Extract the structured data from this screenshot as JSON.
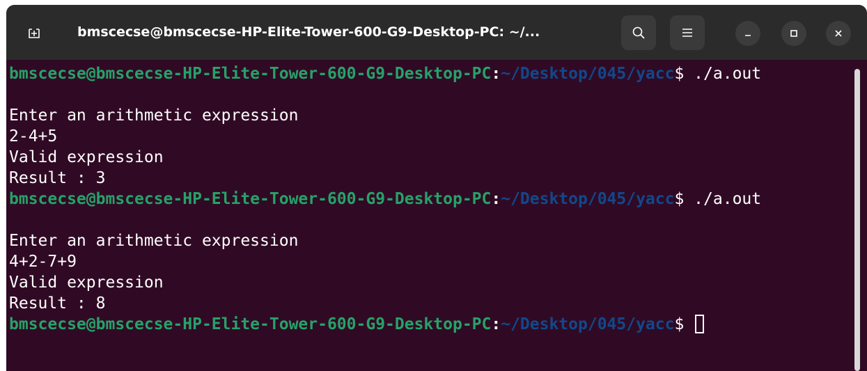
{
  "window": {
    "title": "bmscecse@bmscecse-HP-Elite-Tower-600-G9-Desktop-PC: ~/..."
  },
  "header_buttons": {
    "new_tab": "new-tab-icon",
    "search": "search-icon",
    "menu": "hamburger-menu-icon",
    "minimize": "minimize-icon",
    "maximize": "maximize-icon",
    "close": "close-icon"
  },
  "colors": {
    "terminal_bg": "#300a24",
    "titlebar_bg": "#2b2b2b",
    "prompt_user": "#26a269",
    "prompt_path": "#12488b",
    "text": "#ffffff"
  },
  "terminal": {
    "prompt": {
      "user_host": "bmscecse@bmscecse-HP-Elite-Tower-600-G9-Desktop-PC",
      "colon": ":",
      "path": "~/Desktop/045/yacc",
      "dollar": "$"
    },
    "lines": [
      {
        "type": "prompt",
        "command": " ./a.out"
      },
      {
        "type": "output",
        "text": ""
      },
      {
        "type": "output",
        "text": "Enter an arithmetic expression"
      },
      {
        "type": "output",
        "text": "2-4+5"
      },
      {
        "type": "output",
        "text": "Valid expression"
      },
      {
        "type": "output",
        "text": "Result : 3"
      },
      {
        "type": "prompt",
        "command": " ./a.out"
      },
      {
        "type": "output",
        "text": ""
      },
      {
        "type": "output",
        "text": "Enter an arithmetic expression"
      },
      {
        "type": "output",
        "text": "4+2-7+9"
      },
      {
        "type": "output",
        "text": "Valid expression"
      },
      {
        "type": "output",
        "text": "Result : 8"
      },
      {
        "type": "prompt",
        "command": " ",
        "cursor": true
      }
    ]
  }
}
